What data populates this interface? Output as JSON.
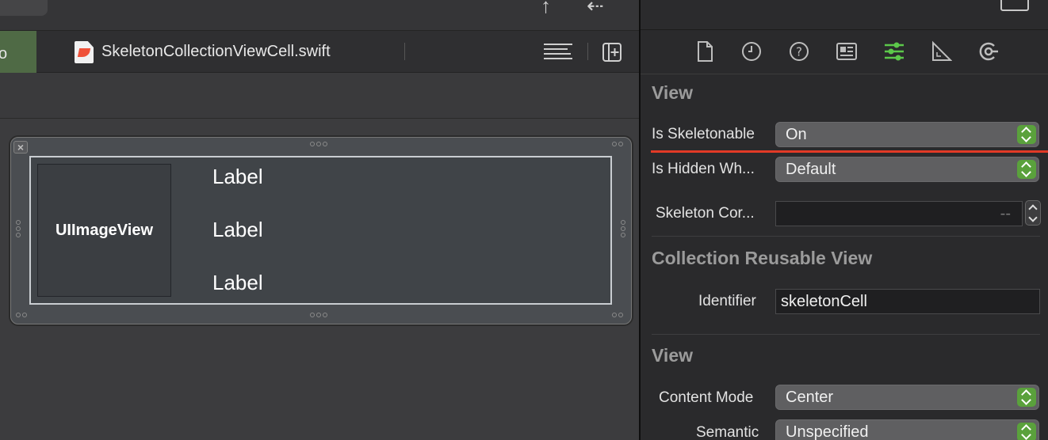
{
  "editor": {
    "active_tab_label": "o",
    "file_tab": "SkeletonCollectionViewCell.swift",
    "cell": {
      "imageview_label": "UIImageView",
      "labels": [
        "Label",
        "Label",
        "Label"
      ],
      "close_glyph": "×"
    }
  },
  "inspector": {
    "tabs": [
      "file-icon",
      "history-icon",
      "help-icon",
      "identity-icon",
      "attributes-icon",
      "size-icon",
      "connections-icon"
    ],
    "active_tab_color": "#5cc84a",
    "section1": {
      "title": "View",
      "is_skeletonable_label": "Is Skeletonable",
      "is_skeletonable_value": "On",
      "is_hidden_label": "Is Hidden Wh...",
      "is_hidden_value": "Default",
      "corner_label": "Skeleton Cor...",
      "corner_placeholder": "--"
    },
    "section2": {
      "title": "Collection Reusable View",
      "identifier_label": "Identifier",
      "identifier_value": "skeletonCell"
    },
    "section3": {
      "title": "View",
      "content_mode_label": "Content Mode",
      "content_mode_value": "Center",
      "semantic_label": "Semantic",
      "semantic_value": "Unspecified"
    },
    "highlight_color": "#e23a26"
  }
}
